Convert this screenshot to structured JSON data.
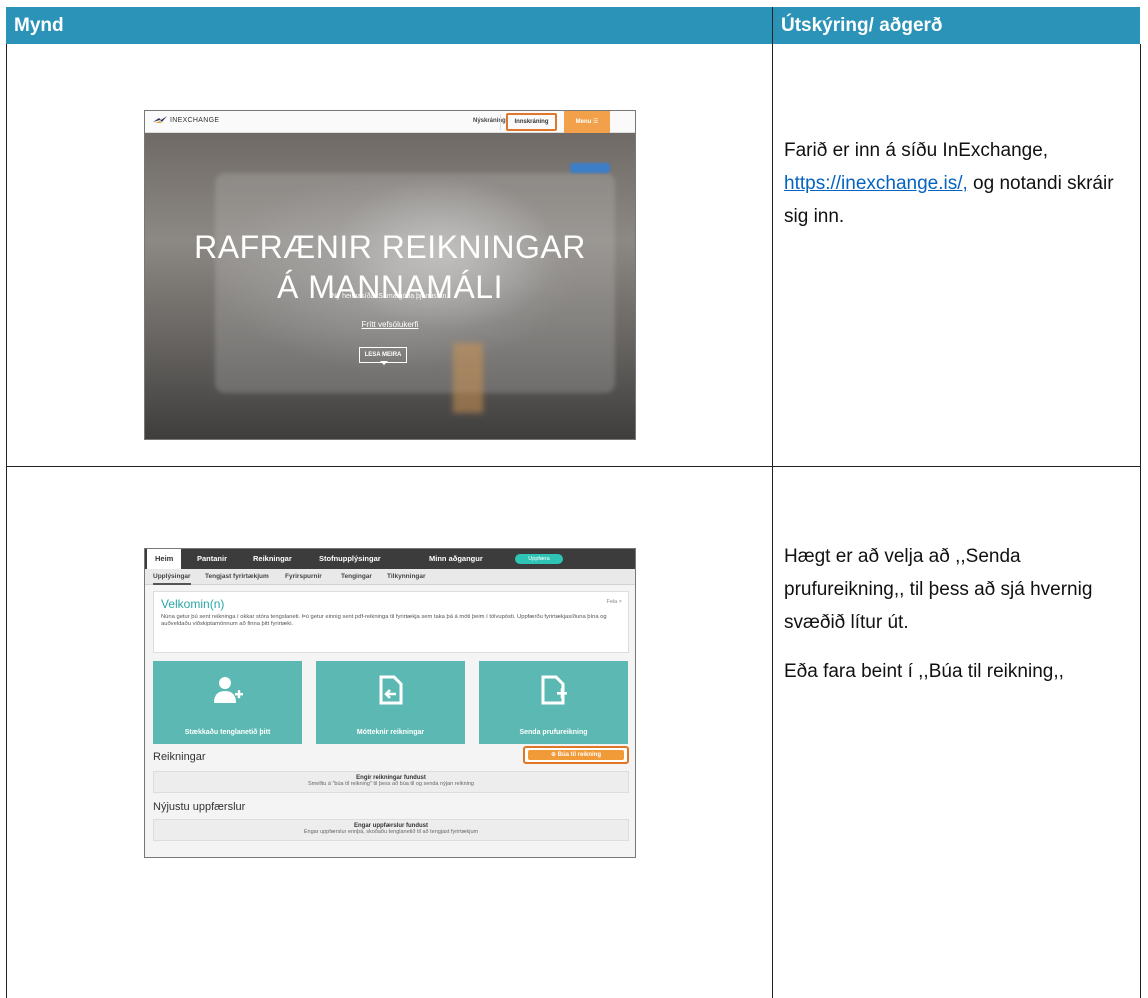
{
  "header": {
    "col1": "Mynd",
    "col2": "Útskýring/ aðgerð"
  },
  "row1": {
    "text_before_link": "Farið er inn á síðu InExchange,",
    "link": "https://inexchange.is/,",
    "text_after_link": " og notandi skráir sig inn.",
    "screenshot": {
      "logo": "INEXCHANGE",
      "nav_signup": "Nýskráning",
      "nav_login": "Innskráning",
      "nav_menu": "Menu ☰",
      "hero_line1": "RAFRÆNIR REIKNINGAR",
      "hero_line2": "Á MANNAMÁLI",
      "hero_sub": "Ný heimasíða. Sama góða þjónustan.",
      "hero_link": "Frítt vefsölukerfi",
      "hero_button": "LESA MEIRA",
      "highlight_color": "#e0762a"
    }
  },
  "row2": {
    "paragraph1": "Hægt er að velja að ,,Senda prufureikning,, til þess að sjá hvernig svæðið lítur út.",
    "paragraph2": "Eða fara beint í ,,Búa til reikning,,",
    "screenshot": {
      "nav": [
        "Heim",
        "Pantanir",
        "Reikningar",
        "Stofnupplýsingar",
        "Minn aðgangur"
      ],
      "nav_pill": "Uppfæra",
      "subnav": [
        "Upplýsingar",
        "Tengjast fyrirtækjum",
        "Fyrirspurnir",
        "Tengingar",
        "Tilkynningar"
      ],
      "welcome_title": "Velkomin(n)",
      "welcome_hide": "Fela ×",
      "welcome_body": "Núna getur þú sent reikninga í okkar stóra tengslaneti. Þú getur einnig sent pdf-reikninga til fyrirtækja sem taka þá á móti þeim í tölvupósti. Uppfærðu fyrirtækjasíðuna þína og auðveldaðu viðskiptamönnum að finna þitt fyrirtæki.",
      "tiles": [
        {
          "label": "Stækkaðu tenglanetið þitt",
          "icon": "add-user-icon"
        },
        {
          "label": "Mótteknir reikningar",
          "icon": "document-in-icon"
        },
        {
          "label": "Senda prufureikning",
          "icon": "document-add-icon"
        }
      ],
      "invoices_title": "Reikningar",
      "create_button": "⊕ Búa til reikning",
      "invoices_empty_title": "Engir reikningar fundust",
      "invoices_empty_body": "Smelltu á \"búa til reikning\" til þess að búa til og senda nýjan reikning",
      "updates_title": "Nýjustu uppfærslur",
      "updates_empty_title": "Engar uppfærslur fundust",
      "updates_empty_body": "Engar uppfærslur ennþá, skoðaðu tenglanetið til að tengjast fyrirtækjum",
      "accent_color": "#5cb8b2",
      "highlight_color": "#e0762a"
    }
  }
}
